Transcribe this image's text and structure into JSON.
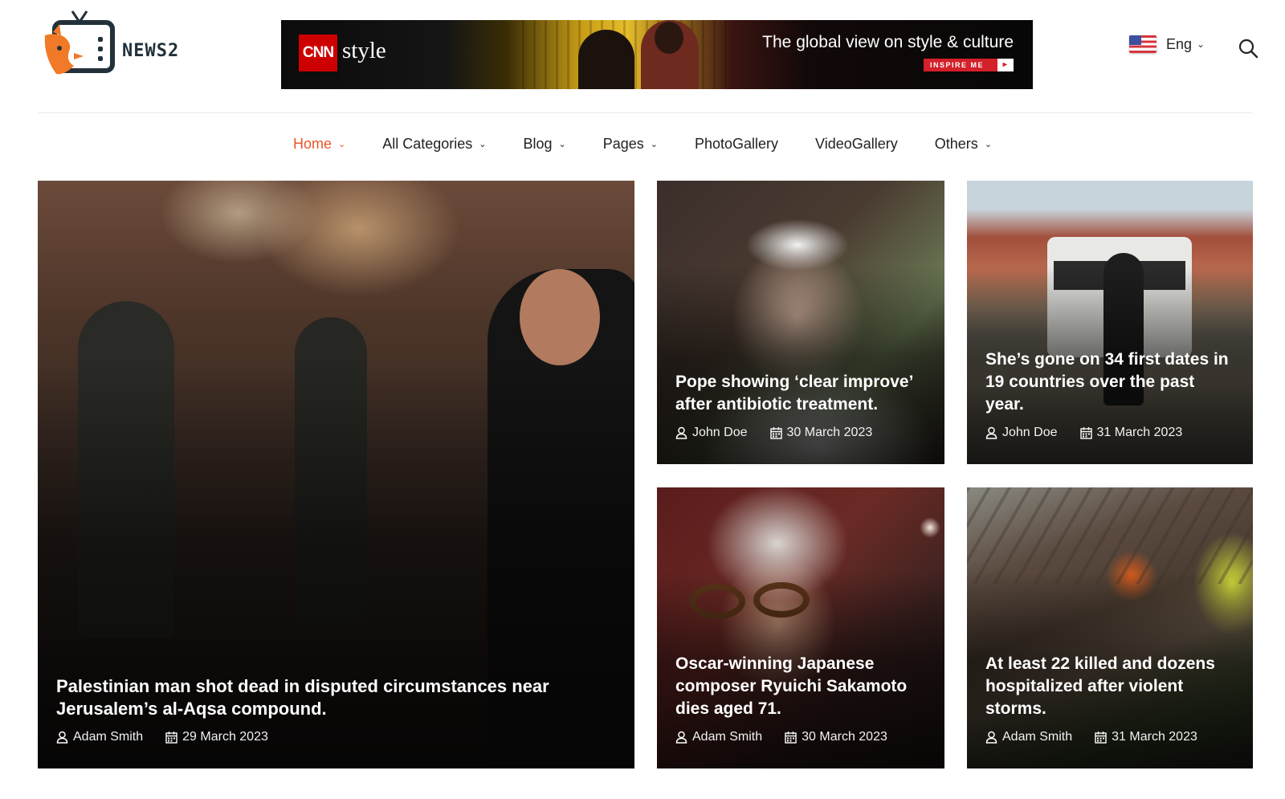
{
  "header": {
    "logo_text": "NEWS2",
    "ad": {
      "brand": "CNN",
      "product": "style",
      "tagline": "The global view on style & culture",
      "cta": "INSPIRE ME"
    },
    "language": {
      "label": "Eng",
      "flag": "us-flag-icon"
    },
    "search_icon": "search-icon"
  },
  "nav": {
    "items": [
      {
        "label": "Home",
        "active": true,
        "dropdown": true
      },
      {
        "label": "All Categories",
        "dropdown": true
      },
      {
        "label": "Blog",
        "dropdown": true
      },
      {
        "label": "Pages",
        "dropdown": true
      },
      {
        "label": "PhotoGallery",
        "dropdown": false
      },
      {
        "label": "VideoGallery",
        "dropdown": false
      },
      {
        "label": "Others",
        "dropdown": true
      }
    ]
  },
  "colors": {
    "accent": "#e8552b",
    "text": "#222222",
    "divider": "#e9e9e9"
  },
  "articles": [
    {
      "title": "Palestinian man shot dead in disputed circumstances near Jerusalem’s al-Aqsa compound.",
      "author": "Adam Smith",
      "date": "29 March 2023"
    },
    {
      "title": "Pope showing ‘clear improve’ after antibiotic treatment.",
      "author": "John Doe",
      "date": "30 March 2023"
    },
    {
      "title": "She’s gone on 34 first dates in 19 countries over the past year.",
      "author": "John Doe",
      "date": "31 March 2023"
    },
    {
      "title": "Oscar-winning Japanese composer Ryuichi Sakamoto dies aged 71.",
      "author": "Adam Smith",
      "date": "30 March 2023"
    },
    {
      "title": "At least 22 killed and dozens hospitalized after violent storms.",
      "author": "Adam Smith",
      "date": "31 March 2023"
    }
  ]
}
